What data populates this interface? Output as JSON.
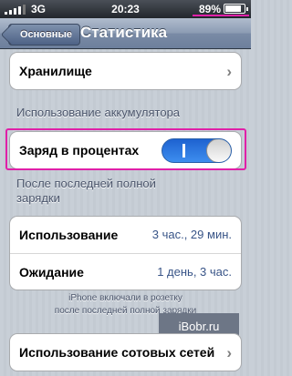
{
  "status_bar": {
    "carrier": "3G",
    "time": "20:23",
    "battery_percent": "89%",
    "battery_level": 0.89,
    "signal_bars": 4
  },
  "nav": {
    "back_label": "Основные",
    "title": "Статистика"
  },
  "storage_row": {
    "label": "Хранилище"
  },
  "battery_section": {
    "header": "Использование аккумулятора"
  },
  "percent_row": {
    "label": "Заряд в процентах",
    "toggle_state": "on",
    "toggle_on_glyph": "I"
  },
  "since_charge": {
    "header_line1": "После последней полной",
    "header_line2": "зарядки",
    "rows": [
      {
        "label": "Использование",
        "value": "3 час., 29 мин."
      },
      {
        "label": "Ожидание",
        "value": "1 день, 3 час."
      }
    ],
    "footer_line1": "iPhone включали в розетку",
    "footer_line2": "после последней полной зарядки"
  },
  "cellular_row": {
    "label": "Использование сотовых сетей"
  },
  "watermark": "iBobr.ru",
  "colors": {
    "highlight": "#e020a8",
    "toggle_on": "#2f7ae6"
  }
}
